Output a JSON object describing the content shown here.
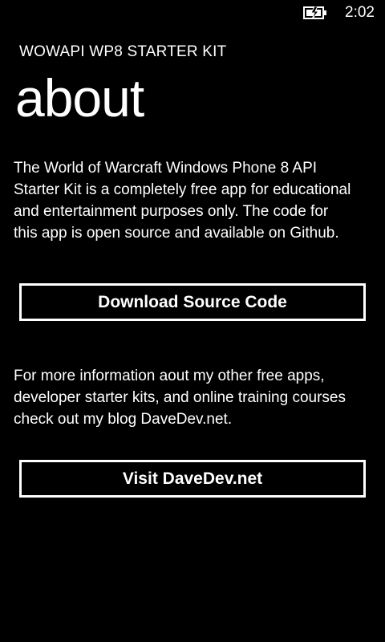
{
  "status_bar": {
    "time": "2:02",
    "battery_icon": "battery-charging-icon"
  },
  "header": {
    "app_title": "WOWAPI WP8 STARTER KIT",
    "page_title": "about"
  },
  "content": {
    "intro_text": "The World of Warcraft Windows Phone 8 API\nStarter Kit is a completely free app for educational\nand entertainment purposes only.  The code for\nthis app is open source and available on Github.",
    "download_button_label": "Download Source Code",
    "more_info_text": "For more information aout my other free apps,\ndeveloper starter kits, and online training courses\ncheck out my blog DaveDev.net.",
    "visit_button_label": "Visit DaveDev.net"
  },
  "colors": {
    "background": "#000000",
    "foreground": "#ffffff"
  }
}
